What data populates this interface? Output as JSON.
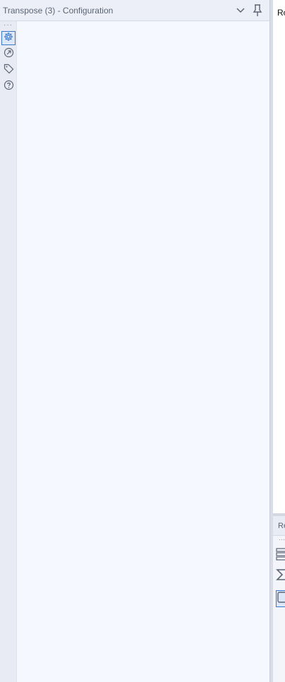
{
  "config_panel": {
    "title": "Transpose (3) - Configuration",
    "icons": {
      "collapse": "chevron-down-icon",
      "pin": "pin-icon"
    },
    "rail": [
      {
        "name": "configuration",
        "icon": "gear-icon",
        "active": true
      },
      {
        "name": "output",
        "icon": "output-arrow-icon",
        "active": false
      },
      {
        "name": "annotation",
        "icon": "tag-icon",
        "active": false
      },
      {
        "name": "help",
        "icon": "question-icon",
        "active": false
      }
    ]
  },
  "canvas": {
    "label": "Ro"
  },
  "results_panel": {
    "title": "Re",
    "rail": [
      {
        "name": "table-view",
        "icon": "rows-icon"
      },
      {
        "name": "summary",
        "icon": "sigma-icon"
      },
      {
        "name": "cell-view",
        "icon": "square-icon",
        "active": true
      }
    ]
  },
  "colors": {
    "accent": "#3c78c9",
    "panel_bg": "#f5f8fe",
    "header_bg": "#eceff7"
  }
}
